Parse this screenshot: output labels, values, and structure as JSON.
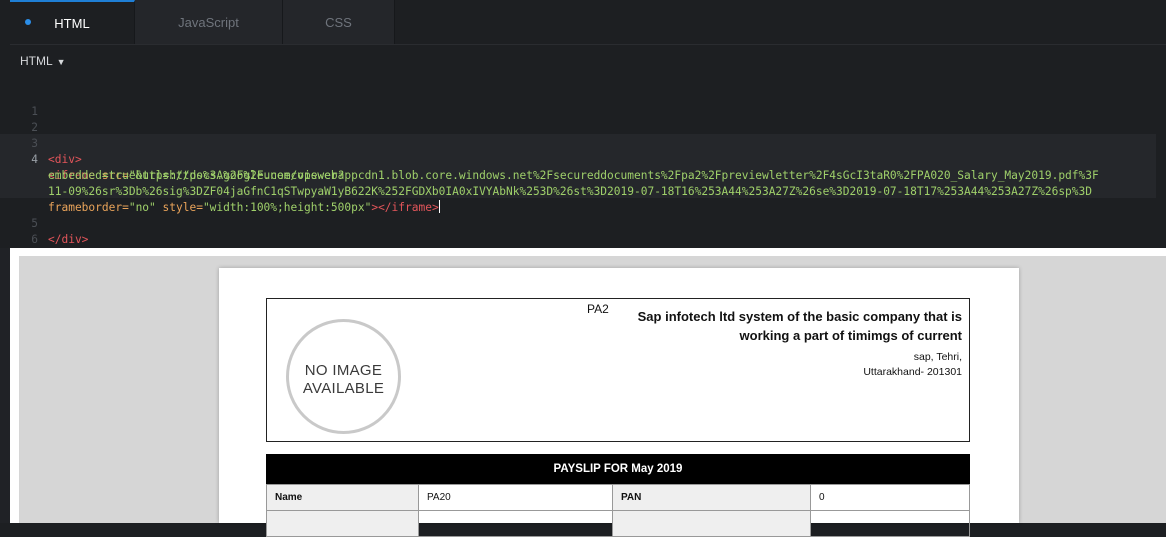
{
  "editor": {
    "tabs": [
      {
        "label": "HTML",
        "active": true
      },
      {
        "label": "JavaScript",
        "active": false
      },
      {
        "label": "CSS",
        "active": false
      }
    ],
    "language_label": "HTML",
    "line_numbers": [
      "1",
      "2",
      "3",
      "4",
      "",
      "",
      "",
      "5",
      "6"
    ],
    "code": {
      "line3": "<div>",
      "line4_a_tag": "<iframe",
      "line4_a_attr": " src=",
      "line4_a_str": "\"https://docs.google.com/viewer?",
      "line4_b": "embedded=true&url=https%3A%2F%2Funeecopswebappcdn1.blob.core.windows.net%2Fsecureddocuments%2Fpa2%2Fpreviewletter%2F4sGcI3taR0%2FPA020_Salary_May2019.pdf%3F",
      "line4_c": "11-09%26sr%3Db%26sig%3DZF04jaGfnC1qSTwpyaW1yB622K%252FGDXb0IA0xIVYAbNk%253D%26st%3D2019-07-18T16%253A44%253A27Z%26se%3D2019-07-18T17%253A44%253A27Z%26sp%3D",
      "line4_d_attr1": "frameborder=",
      "line4_d_str1": "\"no\"",
      "line4_d_attr2": " style=",
      "line4_d_str2": "\"width:100%;height:500px\"",
      "line4_d_tag1": "></iframe",
      "line4_d_tag2": ">",
      "line5": "</div>"
    },
    "colors": {
      "background": "#1d1f22",
      "active_tab_indicator": "#1f7fd6",
      "tag": "#e2555a",
      "attr": "#e9a35a",
      "string": "#9fd06a"
    }
  },
  "document": {
    "pa_code": "PA2",
    "no_image_line1": "NO IMAGE",
    "no_image_line2": "AVAILABLE",
    "company_line1": "Sap infotech ltd system of the basic company  that is",
    "company_line2": "working a part of timimgs of current",
    "address_line1": "sap, Tehri,",
    "address_line2": "Uttarakhand- 201301",
    "payslip_title": "PAYSLIP FOR May 2019",
    "rows": [
      {
        "label1": "Name",
        "value1": "PA20",
        "label2": "PAN",
        "value2": "0"
      },
      {
        "label1": "",
        "value1": "",
        "label2": "",
        "value2": ""
      }
    ]
  }
}
